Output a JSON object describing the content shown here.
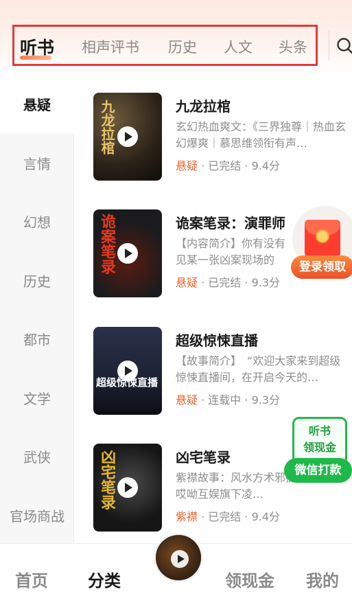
{
  "header": {
    "tabs": [
      {
        "label": "听书",
        "active": true
      },
      {
        "label": "相声评书",
        "active": false
      },
      {
        "label": "历史",
        "active": false
      },
      {
        "label": "人文",
        "active": false
      },
      {
        "label": "头条",
        "active": false
      }
    ],
    "search_icon": "search-icon",
    "highlight_color": "#e23b3b"
  },
  "sidebar": {
    "items": [
      {
        "label": "悬疑",
        "active": true
      },
      {
        "label": "言情",
        "active": false
      },
      {
        "label": "幻想",
        "active": false
      },
      {
        "label": "历史",
        "active": false
      },
      {
        "label": "都市",
        "active": false
      },
      {
        "label": "文学",
        "active": false
      },
      {
        "label": "武侠",
        "active": false
      },
      {
        "label": "官场商战",
        "active": false
      }
    ]
  },
  "books": [
    {
      "title": "九龙拉棺",
      "description": "玄幻热血爽文：《三界独尊｜热血玄幻爆爽｜慕思维领衔有声…",
      "genre": "悬疑",
      "status": "已完结",
      "rating": "9.4分",
      "cover_text": "九龙拉棺",
      "cover_color": "#2b2218"
    },
    {
      "title": "诡案笔录：演罪师",
      "description": "【内容简介】你有没有见某一张凶案现场的照…",
      "genre": "悬疑",
      "status": "已完结",
      "rating": "9.3分",
      "cover_text": "诡案笔录",
      "cover_color": "#1b1b1d"
    },
    {
      "title": "超级惊悚直播",
      "description": "【故事简介】　“欢迎大家来到超级惊悚直播间，在开启今天的…",
      "genre": "悬疑",
      "status": "连载中",
      "rating": "9.3分",
      "cover_text": "超级惊悚直播",
      "cover_color": "#1d2233"
    },
    {
      "title": "凶宅笔录",
      "description": "紫襟故事：风水方术邪捉鬼破凶局哎呦互娱旗下凌…",
      "genre": "紫襟",
      "status": "已完结",
      "rating": "9.4分",
      "cover_text": "凶宅笔录",
      "cover_color": "#161616"
    }
  ],
  "floating": {
    "redpack_label": "登录领取",
    "wechat_card_line1": "听书",
    "wechat_card_line2": "领现金",
    "wechat_button": "微信打款"
  },
  "bottom_nav": {
    "items": [
      {
        "label": "首页",
        "active": false
      },
      {
        "label": "分类",
        "active": true
      },
      {
        "label": "领现金",
        "active": false
      },
      {
        "label": "我的",
        "active": false
      }
    ],
    "player_icon": "play-icon"
  },
  "colors": {
    "accent": "#e8662e",
    "wechat_green": "#1fb94a",
    "redpack_red": "#ff3d2e"
  }
}
